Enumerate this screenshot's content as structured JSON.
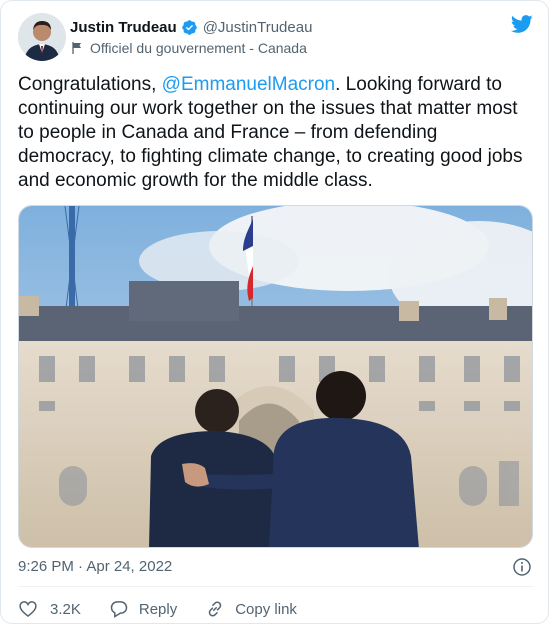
{
  "author": {
    "display_name": "Justin Trudeau",
    "handle": "@JustinTrudeau",
    "label": "Officiel du gouvernement - Canada",
    "avatar_icon": "person-avatar",
    "verified_icon": "verified-badge-icon",
    "label_icon": "flag-icon"
  },
  "brand": {
    "logo_icon": "twitter-bird-icon",
    "accent_color": "#1d9bf0"
  },
  "tweet": {
    "text_before": "Congratulations, ",
    "mention": "@EmmanuelMacron",
    "text_after": ". Looking forward to continuing our work together on the issues that matter most to people in Canada and France – from defending democracy, to fighting climate change, to creating good jobs and economic growth for the middle class.",
    "timestamp": "9:26 PM · Apr 24, 2022"
  },
  "actions": {
    "like_count": "3.2K",
    "reply_label": "Reply",
    "copy_link_label": "Copy link"
  }
}
